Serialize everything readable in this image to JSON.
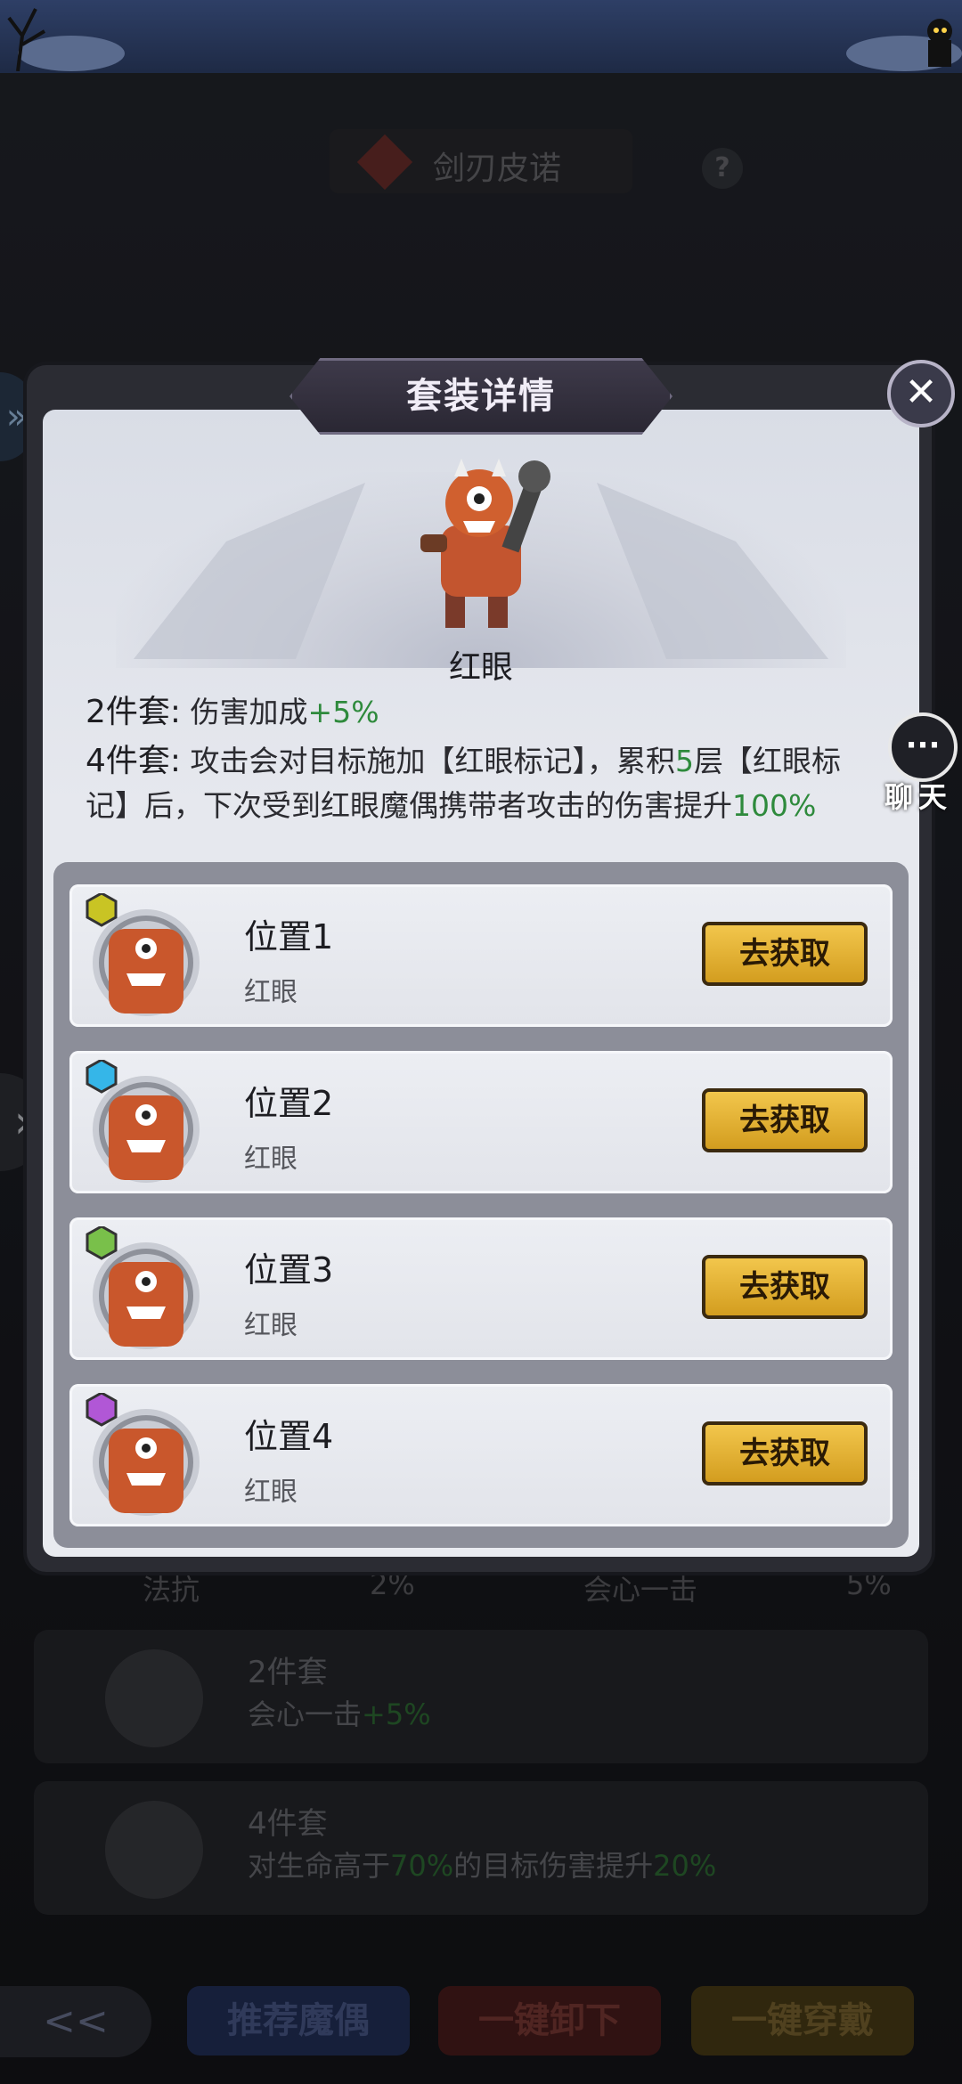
{
  "hero": {
    "name": "剑刃皮诺",
    "help": "?"
  },
  "chat": {
    "label": "聊天"
  },
  "modal": {
    "title": "套装详情",
    "close": "✕",
    "set_name": "红眼",
    "bonus_2": {
      "label": "2件套:",
      "text": "伤害加成",
      "value": "+5%"
    },
    "bonus_4": {
      "label": "4件套:",
      "text_a": "攻击会对目标施加【红眼标记】，累积",
      "count": "5",
      "text_b": "层【红眼标记】后，下次受到红眼魔偶携带者攻击的伤害提升",
      "value": "100%"
    },
    "slots": [
      {
        "title": "位置1",
        "sub": "红眼",
        "button": "去获取",
        "gem_color": "#c9c424"
      },
      {
        "title": "位置2",
        "sub": "红眼",
        "button": "去获取",
        "gem_color": "#35b6e8"
      },
      {
        "title": "位置3",
        "sub": "红眼",
        "button": "去获取",
        "gem_color": "#79c04a"
      },
      {
        "title": "位置4",
        "sub": "红眼",
        "button": "去获取",
        "gem_color": "#b157d6"
      }
    ]
  },
  "background": {
    "stats": [
      {
        "label": "法抗",
        "value": "2%"
      },
      {
        "label": "会心一击",
        "value": "5%"
      }
    ],
    "set_cards": [
      {
        "title": "2件套",
        "desc_a": "会心一击",
        "value": "+5%"
      },
      {
        "title": "4件套",
        "desc_a": "对生命高于",
        "value_a": "70%",
        "desc_b": "的目标伤害提升",
        "value_b": "20%"
      }
    ]
  },
  "bottom": {
    "recommend": "推荐魔偶",
    "unequip": "一键卸下",
    "equip": "一键穿戴"
  }
}
